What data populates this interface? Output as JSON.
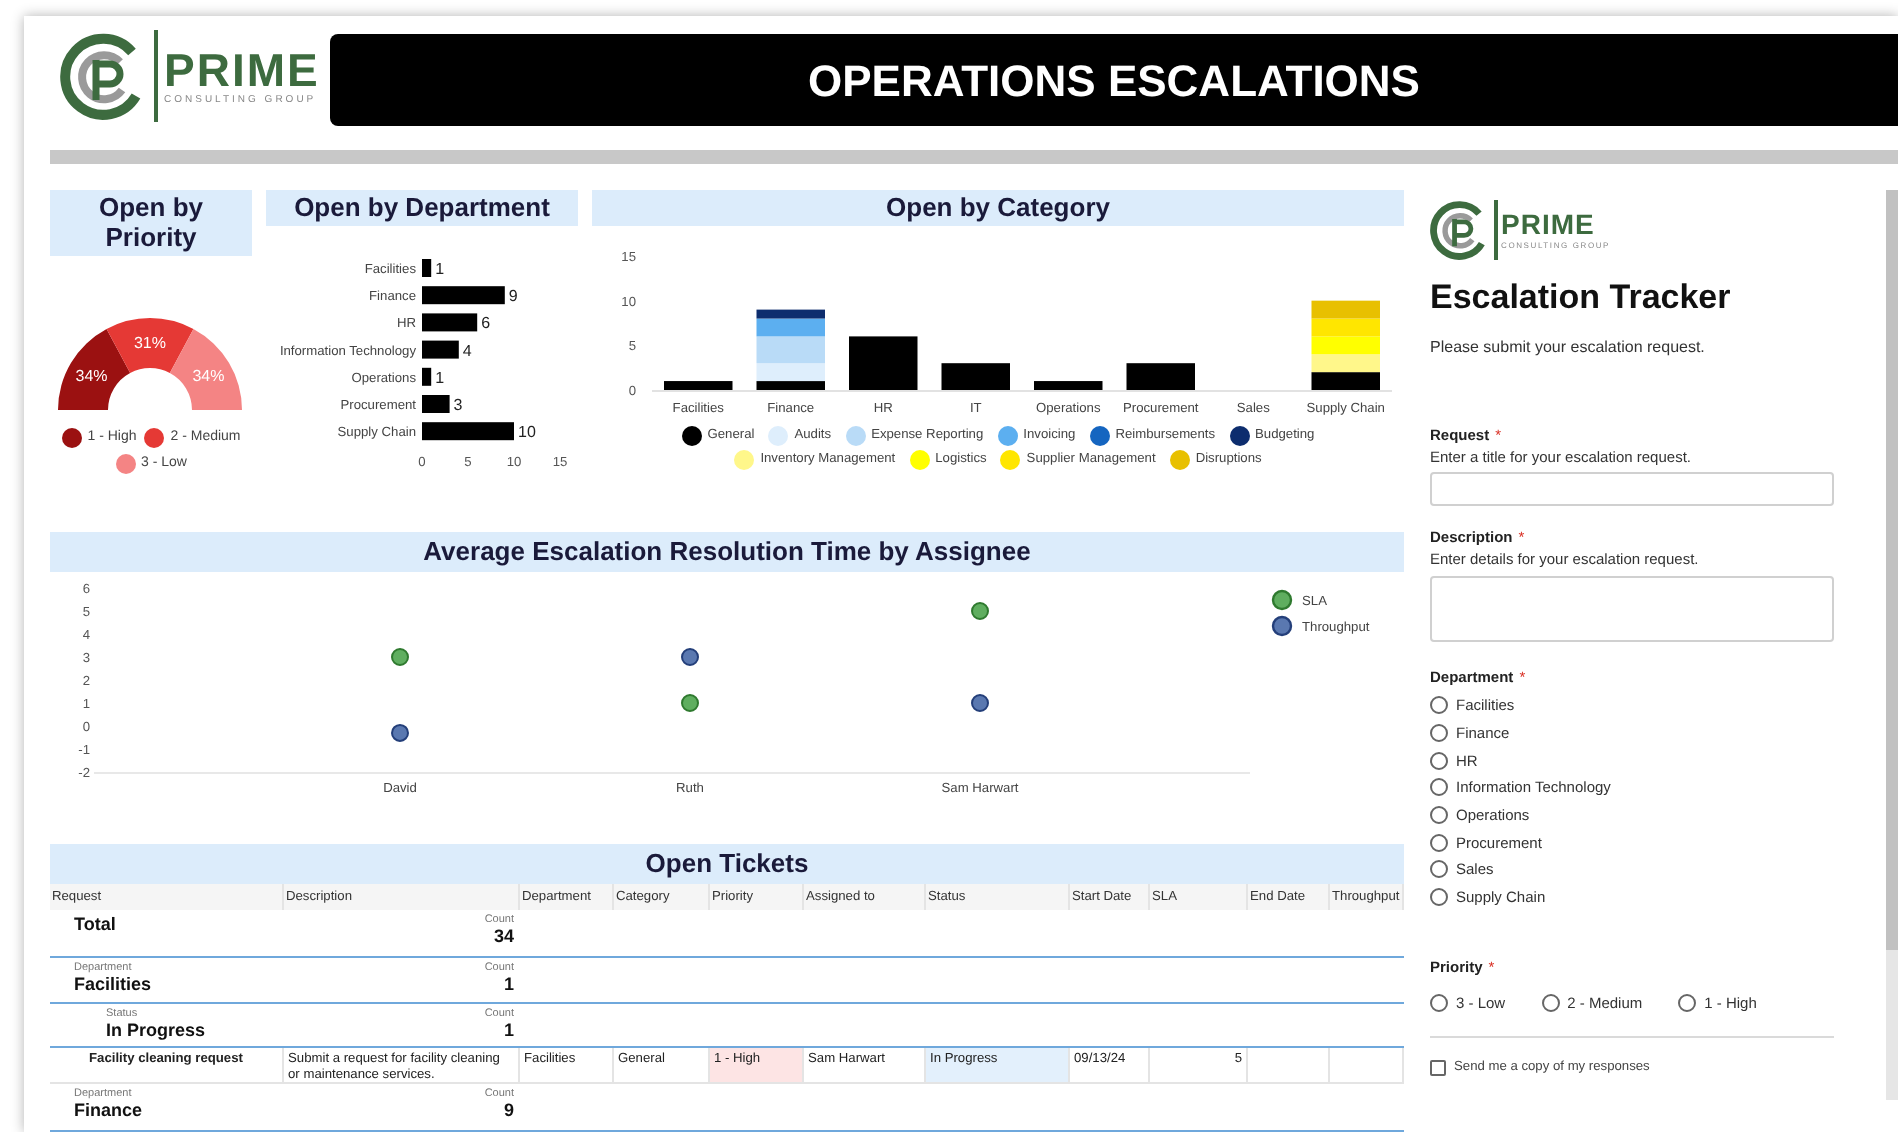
{
  "header": {
    "logo": {
      "name": "PRIME",
      "tagline": "CONSULTING GROUP"
    },
    "title": "OPERATIONS ESCALATIONS"
  },
  "priority_panel": {
    "title": "Open by Priority",
    "chart_data": {
      "type": "donut",
      "categories": [
        "1 - High",
        "2 - Medium",
        "3 - Low"
      ],
      "values": [
        34,
        31,
        34
      ],
      "colors": [
        "#9b1111",
        "#e53935",
        "#f48484"
      ],
      "value_labels": [
        "34%",
        "31%",
        "34%"
      ],
      "legend": "bottom"
    }
  },
  "department_panel": {
    "title": "Open by Department",
    "chart_data": {
      "type": "bar",
      "orientation": "horizontal",
      "categories": [
        "Facilities",
        "Finance",
        "HR",
        "Information Technology",
        "Operations",
        "Procurement",
        "Supply Chain"
      ],
      "values": [
        1,
        9,
        6,
        4,
        1,
        3,
        10
      ],
      "xlim": [
        0,
        15
      ],
      "xticks": [
        0,
        5,
        10,
        15
      ],
      "data_labels": true
    }
  },
  "category_panel": {
    "title": "Open by Category",
    "chart_data": {
      "type": "bar",
      "stacked": true,
      "categories": [
        "Facilities",
        "Finance",
        "HR",
        "IT",
        "Operations",
        "Procurement",
        "Sales",
        "Supply Chain"
      ],
      "ylim": [
        0,
        15
      ],
      "yticks": [
        0,
        5,
        10,
        15
      ],
      "series": [
        {
          "name": "General",
          "color": "#000000",
          "values": [
            1,
            1,
            6,
            3,
            1,
            3,
            0,
            2
          ]
        },
        {
          "name": "Audits",
          "color": "#deeefc",
          "values": [
            0,
            2,
            0,
            0,
            0,
            0,
            0,
            0
          ]
        },
        {
          "name": "Expense Reporting",
          "color": "#b9dbf7",
          "values": [
            0,
            3,
            0,
            0,
            0,
            0,
            0,
            0
          ]
        },
        {
          "name": "Invoicing",
          "color": "#5caff0",
          "values": [
            0,
            2,
            0,
            0,
            0,
            0,
            0,
            0
          ]
        },
        {
          "name": "Reimbursements",
          "color": "#1565c0",
          "values": [
            0,
            0,
            0,
            0,
            0,
            0,
            0,
            0
          ]
        },
        {
          "name": "Budgeting",
          "color": "#0d2d6e",
          "values": [
            0,
            1,
            0,
            0,
            0,
            0,
            0,
            0
          ]
        },
        {
          "name": "Inventory Management",
          "color": "#fff78a",
          "values": [
            0,
            0,
            0,
            0,
            0,
            0,
            0,
            2
          ]
        },
        {
          "name": "Logistics",
          "color": "#ffff00",
          "values": [
            0,
            0,
            0,
            0,
            0,
            0,
            0,
            2
          ]
        },
        {
          "name": "Supplier Management",
          "color": "#ffe600",
          "values": [
            0,
            0,
            0,
            0,
            0,
            0,
            0,
            2
          ]
        },
        {
          "name": "Disruptions",
          "color": "#e8c000",
          "values": [
            0,
            0,
            0,
            0,
            0,
            0,
            0,
            2
          ]
        }
      ]
    }
  },
  "scatter_panel": {
    "title": "Average Escalation Resolution Time by Assignee",
    "chart_data": {
      "type": "scatter",
      "categories": [
        "David",
        "Ruth",
        "Sam Harwart"
      ],
      "legend": "right",
      "ylim": [
        -2,
        6
      ],
      "yticks": [
        -2,
        -1,
        0,
        1,
        2,
        3,
        4,
        5,
        6
      ],
      "series": [
        {
          "name": "SLA",
          "color": "#5fae5f",
          "values": [
            3,
            1,
            5
          ]
        },
        {
          "name": "Throughput",
          "color": "#5a78b0",
          "values": [
            -0.3,
            3,
            1
          ]
        }
      ]
    }
  },
  "tickets": {
    "title": "Open Tickets",
    "columns": [
      "Request",
      "Description",
      "Department",
      "Category",
      "Priority",
      "Assigned to",
      "Status",
      "Start Date",
      "SLA",
      "End Date",
      "Throughput"
    ],
    "rows": [
      {
        "kind": "total",
        "label": "Total",
        "count_label": "Count",
        "count": "34"
      },
      {
        "kind": "group",
        "caption": "Department",
        "label": "Facilities",
        "count_label": "Count",
        "count": "1"
      },
      {
        "kind": "subgroup",
        "caption": "Status",
        "label": "In Progress",
        "count_label": "Count",
        "count": "1"
      },
      {
        "kind": "record",
        "cells": [
          {
            "text": "Facility cleaning request"
          },
          {
            "text": "Submit a request for facility cleaning or maintenance services."
          },
          {
            "text": "Facilities"
          },
          {
            "text": "General"
          },
          {
            "text": "1 - High",
            "color": "#fde4e4"
          },
          {
            "text": "Sam Harwart"
          },
          {
            "text": "In Progress",
            "color": "#e3f0fc"
          },
          {
            "text": "09/13/24"
          },
          {
            "text": "5"
          }
        ]
      },
      {
        "kind": "group",
        "caption": "Department",
        "label": "Finance",
        "count_label": "Count",
        "count": "9"
      }
    ]
  },
  "form": {
    "logo": {
      "name": "PRIME",
      "tagline": "CONSULTING GROUP"
    },
    "title": "Escalation Tracker",
    "subtitle": "Please submit your escalation request.",
    "questions": [
      {
        "kind": "short",
        "label": "Request",
        "required_mark": "*",
        "hint": "Enter a title for your escalation request."
      },
      {
        "kind": "long",
        "label": "Description",
        "required_mark": "*",
        "hint": "Enter details for your escalation request."
      },
      {
        "kind": "radio",
        "label": "Department",
        "required_mark": "*",
        "options": [
          {
            "label": "Facilities",
            "selected": false
          },
          {
            "label": "Finance",
            "selected": false
          },
          {
            "label": "HR",
            "selected": false
          },
          {
            "label": "Information Technology",
            "selected": false
          },
          {
            "label": "Operations",
            "selected": false
          },
          {
            "label": "Procurement",
            "selected": false
          },
          {
            "label": "Sales",
            "selected": false
          },
          {
            "label": "Supply Chain",
            "selected": false
          }
        ]
      },
      {
        "kind": "radio_row",
        "label": "Priority",
        "required_mark": "*",
        "options": [
          {
            "label": "3 - Low",
            "selected": false
          },
          {
            "label": "2 - Medium",
            "selected": false
          },
          {
            "label": "1 - High",
            "selected": false
          }
        ]
      }
    ],
    "copy": {
      "label": "Send me a copy of my responses",
      "checked": false
    }
  }
}
